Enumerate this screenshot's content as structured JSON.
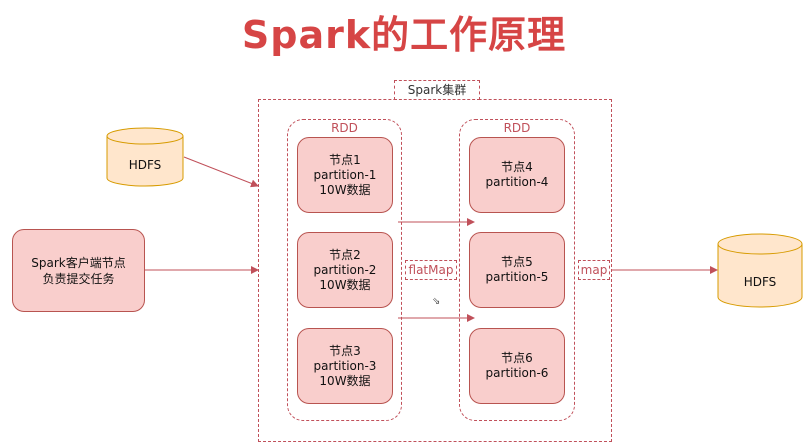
{
  "title": "Spark的工作原理",
  "cluster_label": "Spark集群",
  "client": {
    "line1": "Spark客户端节点",
    "line2": "负责提交任务"
  },
  "hdfs_left": "HDFS",
  "hdfs_right": "HDFS",
  "rdd_left": {
    "title": "RDD",
    "nodes": [
      {
        "name": "节点1",
        "partition": "partition-1",
        "data": "10W数据"
      },
      {
        "name": "节点2",
        "partition": "partition-2",
        "data": "10W数据"
      },
      {
        "name": "节点3",
        "partition": "partition-3",
        "data": "10W数据"
      }
    ]
  },
  "rdd_right": {
    "title": "RDD",
    "nodes": [
      {
        "name": "节点4",
        "partition": "partition-4"
      },
      {
        "name": "节点5",
        "partition": "partition-5"
      },
      {
        "name": "节点6",
        "partition": "partition-6"
      }
    ]
  },
  "ops": {
    "flatmap": "flatMap",
    "map": "map"
  },
  "colors": {
    "title": "#d64545",
    "node_fill": "#f9cecc",
    "node_border": "#b85450",
    "cylinder_fill": "#ffe6cc",
    "cylinder_border": "#d79b00",
    "dashed": "#c0505a"
  }
}
